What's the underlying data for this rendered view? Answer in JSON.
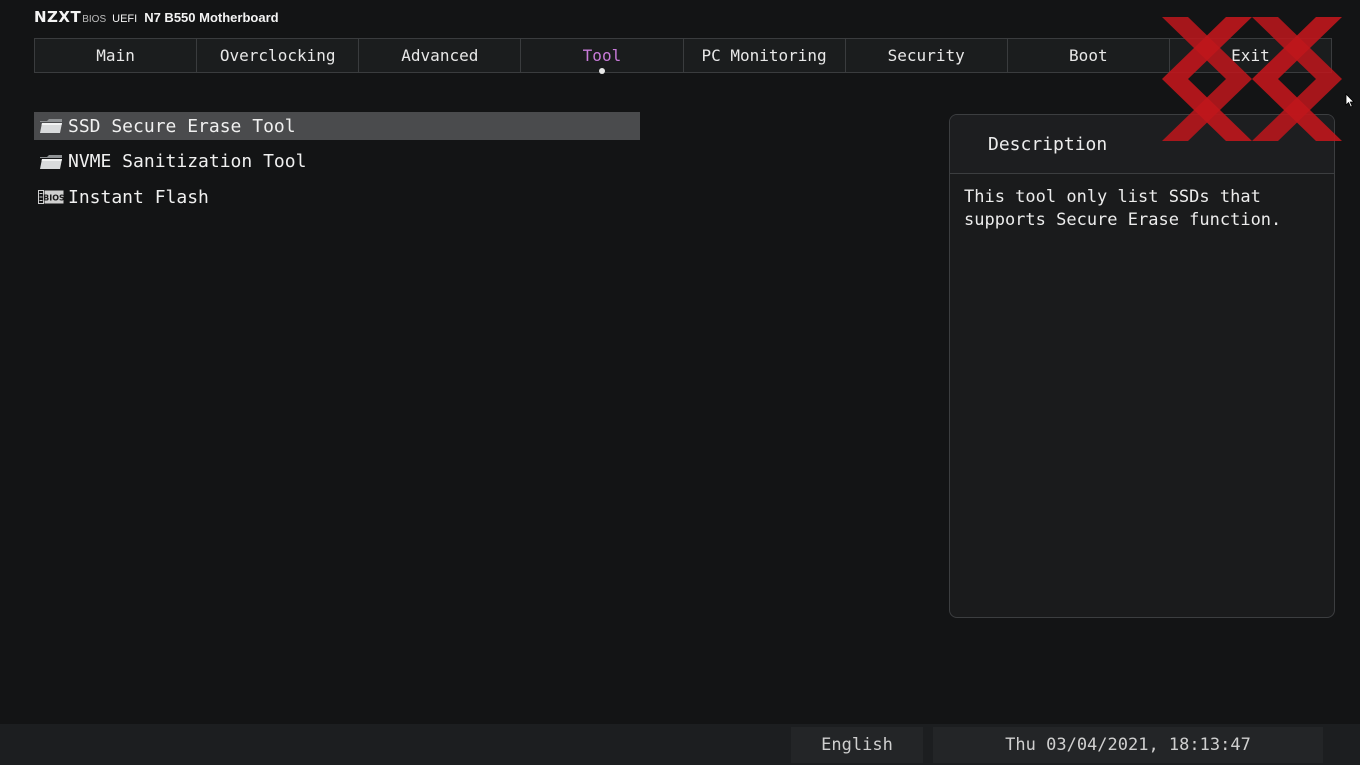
{
  "brand": {
    "logo": "NZXT",
    "bios": "BIOS",
    "uefi": "UEFI",
    "board": "N7 B550 Motherboard"
  },
  "tabs": [
    {
      "label": "Main"
    },
    {
      "label": "Overclocking"
    },
    {
      "label": "Advanced"
    },
    {
      "label": "Tool",
      "active": true
    },
    {
      "label": "PC Monitoring"
    },
    {
      "label": "Security"
    },
    {
      "label": "Boot"
    },
    {
      "label": "Exit"
    }
  ],
  "menu": {
    "items": [
      {
        "label": "SSD Secure Erase Tool",
        "icon": "folder-icon",
        "selected": true
      },
      {
        "label": "NVME Sanitization Tool",
        "icon": "folder-icon"
      },
      {
        "label": "Instant Flash",
        "icon": "bios-chip-icon",
        "icon_text": "BIOS"
      }
    ]
  },
  "description": {
    "title": "Description",
    "text": "This tool only list SSDs that supports Secure Erase function."
  },
  "footer": {
    "language": "English",
    "datetime": "Thu 03/04/2021, 18:13:47"
  },
  "colors": {
    "background": "#131415",
    "accent": "#c77ad8",
    "selected_row": "#4a4b4d",
    "watermark": "#c0161c"
  }
}
